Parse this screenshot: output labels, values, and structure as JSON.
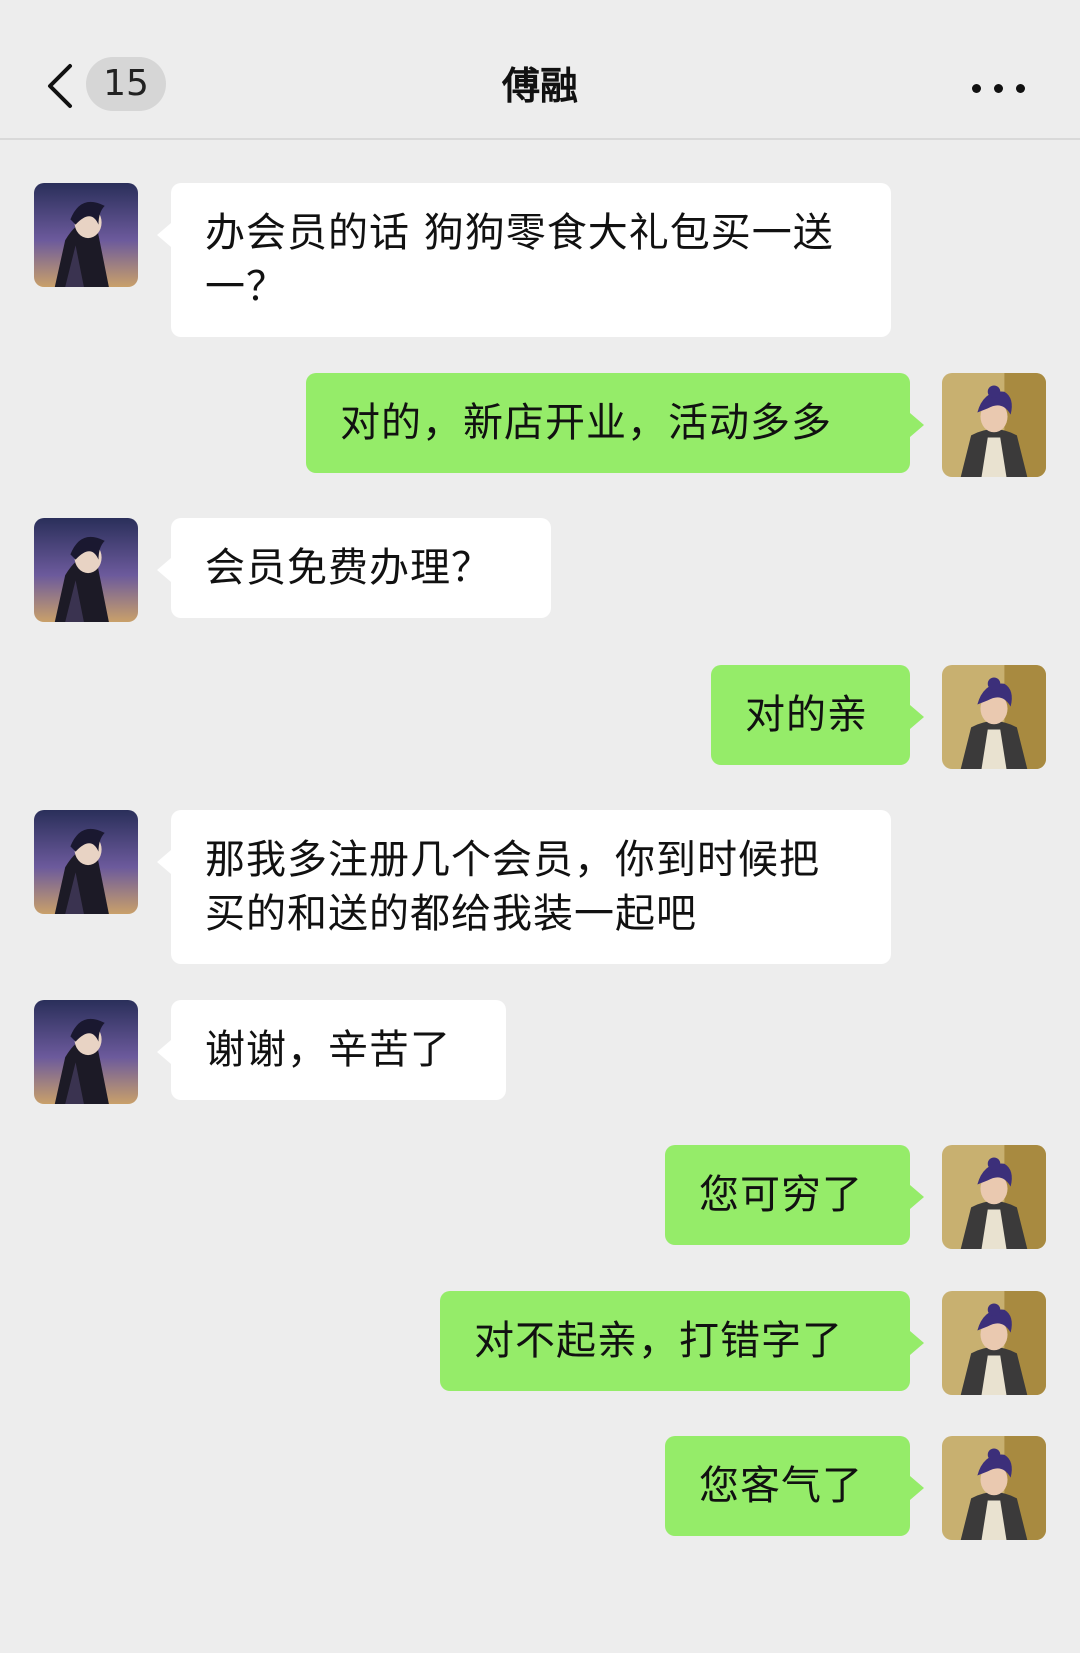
{
  "header": {
    "back_icon": "chevron-left-icon",
    "unread_count": "15",
    "title": "傅融",
    "more_icon": "more-dots-icon"
  },
  "colors": {
    "background": "#ededed",
    "incoming_bubble": "#ffffff",
    "outgoing_bubble": "#95ec69"
  },
  "messages": [
    {
      "side": "left",
      "text": "办会员的话 狗狗零食大礼包买一送一？"
    },
    {
      "side": "right",
      "text": "对的，新店开业，活动多多"
    },
    {
      "side": "left",
      "text": "会员免费办理？"
    },
    {
      "side": "right",
      "text": "对的亲"
    },
    {
      "side": "left",
      "text": "那我多注册几个会员，你到时候把买的和送的都给我装一起吧"
    },
    {
      "side": "left",
      "text": "谢谢，辛苦了"
    },
    {
      "side": "right",
      "text": "您可穷了"
    },
    {
      "side": "right",
      "text": "对不起亲，打错字了"
    },
    {
      "side": "right",
      "text": "您客气了"
    }
  ]
}
